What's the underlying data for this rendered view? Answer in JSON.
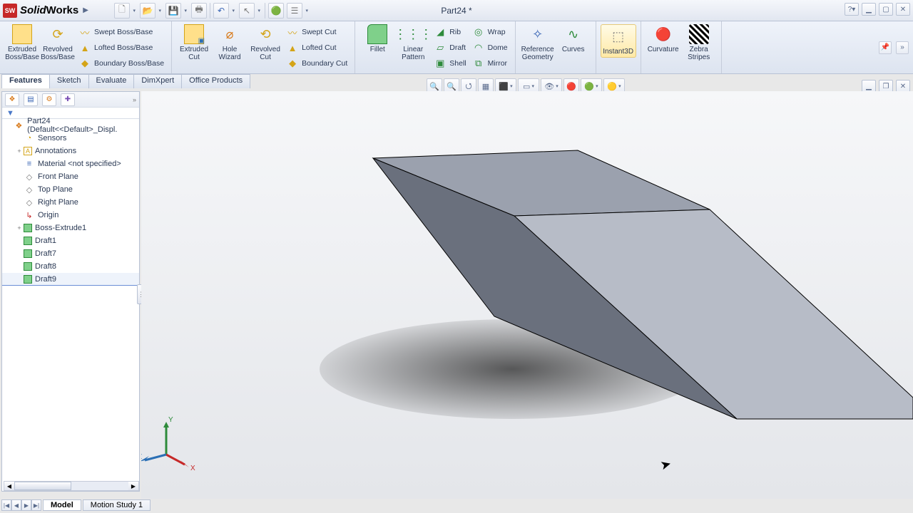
{
  "app_name_1": "Solid",
  "app_name_2": "Works",
  "document_title": "Part24 *",
  "menubar": {
    "help": "?"
  },
  "ribbon": {
    "extruded_boss": "Extruded Boss/Base",
    "revolved_boss": "Revolved Boss/Base",
    "swept_boss": "Swept Boss/Base",
    "lofted_boss": "Lofted Boss/Base",
    "boundary_boss": "Boundary Boss/Base",
    "extruded_cut": "Extruded Cut",
    "hole_wizard": "Hole Wizard",
    "revolved_cut": "Revolved Cut",
    "swept_cut": "Swept Cut",
    "lofted_cut": "Lofted Cut",
    "boundary_cut": "Boundary Cut",
    "fillet": "Fillet",
    "linear_pattern": "Linear Pattern",
    "rib": "Rib",
    "draft": "Draft",
    "shell": "Shell",
    "wrap": "Wrap",
    "dome": "Dome",
    "mirror": "Mirror",
    "ref_geometry": "Reference Geometry",
    "curves": "Curves",
    "instant3d": "Instant3D",
    "curvature": "Curvature",
    "zebra": "Zebra Stripes"
  },
  "tabs": {
    "features": "Features",
    "sketch": "Sketch",
    "evaluate": "Evaluate",
    "dimxpert": "DimXpert",
    "office": "Office Products"
  },
  "tree": {
    "root": "Part24  (Default<<Default>_Displ.",
    "sensors": "Sensors",
    "annotations": "Annotations",
    "material": "Material <not specified>",
    "front": "Front Plane",
    "top": "Top Plane",
    "right": "Right Plane",
    "origin": "Origin",
    "extrude": "Boss-Extrude1",
    "d1": "Draft1",
    "d7": "Draft7",
    "d8": "Draft8",
    "d9": "Draft9"
  },
  "triad": {
    "x": "X",
    "y": "Y",
    "z": "Z"
  },
  "bottom": {
    "model": "Model",
    "motion": "Motion Study 1"
  }
}
